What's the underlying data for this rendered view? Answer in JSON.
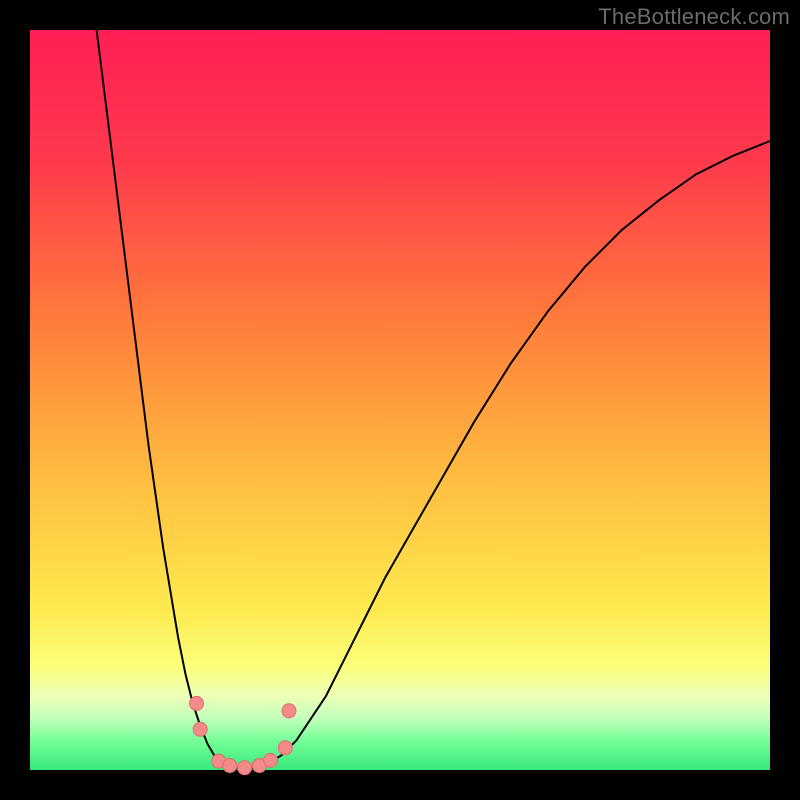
{
  "watermark": "TheBottleneck.com",
  "colors": {
    "gradient": [
      {
        "stop": 0,
        "color": "#ff1e55"
      },
      {
        "stop": 18,
        "color": "#ff3a4c"
      },
      {
        "stop": 40,
        "color": "#ff7e3a"
      },
      {
        "stop": 62,
        "color": "#ffc141"
      },
      {
        "stop": 78,
        "color": "#fee94e"
      },
      {
        "stop": 86,
        "color": "#fbff7a"
      },
      {
        "stop": 90,
        "color": "#eeffb7"
      },
      {
        "stop": 93,
        "color": "#c3ffba"
      },
      {
        "stop": 96,
        "color": "#76ff9a"
      },
      {
        "stop": 100,
        "color": "#36e87b"
      }
    ],
    "curve": "#000000",
    "dot_fill": "#f48b8b",
    "dot_stroke": "#e46a6a"
  },
  "chart_data": {
    "type": "line",
    "title": "",
    "xlabel": "",
    "ylabel": "",
    "xlim": [
      0,
      100
    ],
    "ylim": [
      0,
      100
    ],
    "grid": false,
    "series": [
      {
        "name": "left-curve",
        "x": [
          9,
          10,
          11,
          12,
          13,
          14,
          15,
          16,
          17,
          18,
          19,
          20,
          21,
          22,
          23,
          24,
          25,
          26
        ],
        "y": [
          100,
          92,
          84,
          76,
          68,
          60,
          52,
          44,
          37,
          30,
          24,
          18,
          13,
          9,
          6,
          3.5,
          1.8,
          0.8
        ]
      },
      {
        "name": "floor",
        "x": [
          26,
          27,
          28,
          29,
          30,
          31,
          32
        ],
        "y": [
          0.8,
          0.4,
          0.2,
          0.15,
          0.2,
          0.4,
          0.8
        ]
      },
      {
        "name": "right-curve",
        "x": [
          32,
          34,
          36,
          38,
          40,
          42,
          45,
          48,
          52,
          56,
          60,
          65,
          70,
          75,
          80,
          85,
          90,
          95,
          100
        ],
        "y": [
          0.8,
          2,
          4,
          7,
          10,
          14,
          20,
          26,
          33,
          40,
          47,
          55,
          62,
          68,
          73,
          77,
          80.5,
          83,
          85
        ]
      }
    ],
    "scatter": {
      "name": "dots",
      "points": [
        {
          "x": 22.5,
          "y": 9
        },
        {
          "x": 23,
          "y": 5.5
        },
        {
          "x": 25.5,
          "y": 1.2
        },
        {
          "x": 27,
          "y": 0.6
        },
        {
          "x": 29,
          "y": 0.3
        },
        {
          "x": 31,
          "y": 0.6
        },
        {
          "x": 32.5,
          "y": 1.3
        },
        {
          "x": 34.5,
          "y": 3
        },
        {
          "x": 35,
          "y": 8
        }
      ]
    }
  }
}
